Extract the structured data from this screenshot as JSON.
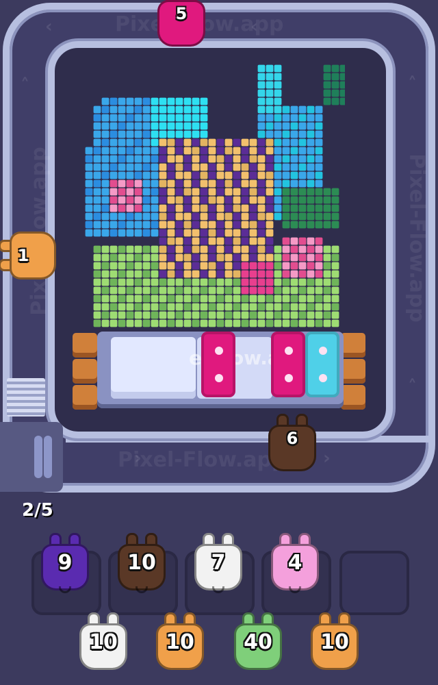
{
  "watermarks": {
    "top": "Pixel-Flow.app",
    "right": "Pixel-Flow.app",
    "bottom": "Pixel-Flow.app",
    "left": "Pixel-Flow.app",
    "tray": "el-flow.app"
  },
  "conveyor_pigs": [
    {
      "id": "top",
      "value": "5",
      "color": "#e0197e",
      "icon": "pig-icon"
    },
    {
      "id": "left",
      "value": "1",
      "color": "#f0a04a",
      "icon": "pig-icon"
    },
    {
      "id": "bottom",
      "value": "6",
      "color": "#5a3826",
      "icon": "pig-icon"
    }
  ],
  "queue_counter": "2/5",
  "tray": {
    "tiles": [
      {
        "color": "#e0197e",
        "dots": 2
      },
      {
        "color": "#e0197e",
        "dots": 2
      },
      {
        "color": "#4fd0e8",
        "dots": 2
      }
    ]
  },
  "slots": [
    {
      "value": "9",
      "color": "#5a2bb0"
    },
    {
      "value": "10",
      "color": "#5a3826"
    },
    {
      "value": "7",
      "color": "#f2f2f2"
    },
    {
      "value": "4",
      "color": "#f4a0dc"
    },
    {
      "value": "",
      "color": ""
    }
  ],
  "waiting_pigs": [
    {
      "value": "10",
      "color": "#f2f2f2"
    },
    {
      "value": "10",
      "color": "#f0a04a"
    },
    {
      "value": "40",
      "color": "#7fcf7a"
    },
    {
      "value": "10",
      "color": "#f0a04a"
    }
  ],
  "colors": {
    "background": "#3c3a5e",
    "track": "#b7bfe0",
    "board": "#2f2d4c"
  }
}
